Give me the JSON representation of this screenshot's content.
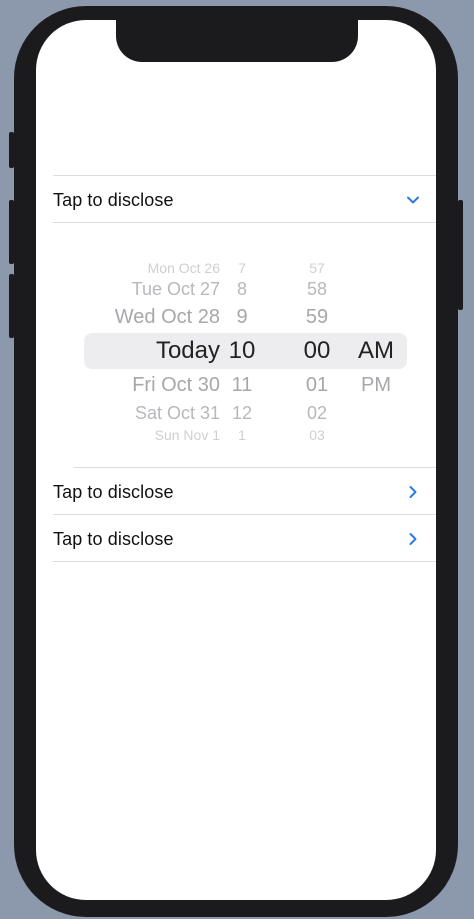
{
  "rows": [
    {
      "label": "Tap to disclose",
      "icon": "chevron-down-icon",
      "expanded": true
    },
    {
      "label": "Tap to disclose",
      "icon": "chevron-right-icon",
      "expanded": false
    },
    {
      "label": "Tap to disclose",
      "icon": "chevron-right-icon",
      "expanded": false
    }
  ],
  "picker": {
    "dates": [
      "Mon Oct 26",
      "Tue Oct 27",
      "Wed Oct 28",
      "Today",
      "Fri Oct 30",
      "Sat Oct 31",
      "Sun Nov 1"
    ],
    "hours": [
      "7",
      "8",
      "9",
      "10",
      "11",
      "12",
      "1"
    ],
    "minutes": [
      "57",
      "58",
      "59",
      "00",
      "01",
      "02",
      "03"
    ],
    "ampm": [
      "AM",
      "PM"
    ]
  },
  "colors": {
    "accent": "#2c7be5",
    "background": "#8c98ac",
    "device": "#1b1b1d",
    "selection_band": "#ededef"
  }
}
